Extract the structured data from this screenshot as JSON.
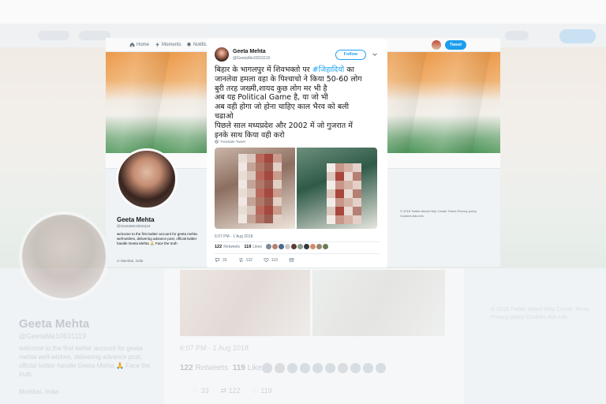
{
  "nav": {
    "home": "Home",
    "moments": "Moments",
    "notifications": "Notifications",
    "tweet_button": "Tweet"
  },
  "profile": {
    "name": "Geeta Mehta",
    "handle": "@GeetaMe10631119",
    "bio": "welcome to the first twitter account for geeta mehta well-wishes, delivering advance post, official twitter handle Geeta Mehta 🙏 Face the truth",
    "location": "Mumbai, India"
  },
  "sidebar_footer": "© 2018 Twitter About Help Center Terms Privacy policy Cookies Ads info",
  "tweet": {
    "author_name": "Geeta Mehta",
    "author_handle": "@GeetaMe10631119",
    "follow_label": "Follow",
    "lines": [
      {
        "pre": "बिहार के भागलपुर में शिवभक्तो पर ",
        "tag": "#जिहादियो",
        "post": " का"
      },
      {
        "pre": "जानलेवा हमला वहा के पिश्चाचो ने किया 50-60 लोग",
        "tag": "",
        "post": ""
      },
      {
        "pre": "बुरी तरह जख्मी,शायद कुछ लोग मर भी है",
        "tag": "",
        "post": ""
      },
      {
        "pre": "अब यह Political Game है, या जो भी",
        "tag": "",
        "post": ""
      },
      {
        "pre": "अब वही होगा जो होना चाहिए काल भैरव को बली",
        "tag": "",
        "post": ""
      },
      {
        "pre": "चढाओ",
        "tag": "",
        "post": ""
      },
      {
        "pre": "पिछले साल मध्यप्रदेश और 2002 में जो गुजरात में",
        "tag": "",
        "post": ""
      },
      {
        "pre": "इनके साथ किया वही करो",
        "tag": "",
        "post": ""
      }
    ],
    "translate_label": "Translate Tweet",
    "timestamp": "6:07 PM - 1 Aug 2018",
    "retweets_count": "122",
    "retweets_label": "Retweets",
    "likes_count": "119",
    "likes_label": "Likes",
    "reply_count": "33",
    "retweet_action_count": "122",
    "like_action_count": "119"
  },
  "colors": {
    "accent": "#1da1f2",
    "text": "#14171a",
    "muted": "#657786"
  }
}
